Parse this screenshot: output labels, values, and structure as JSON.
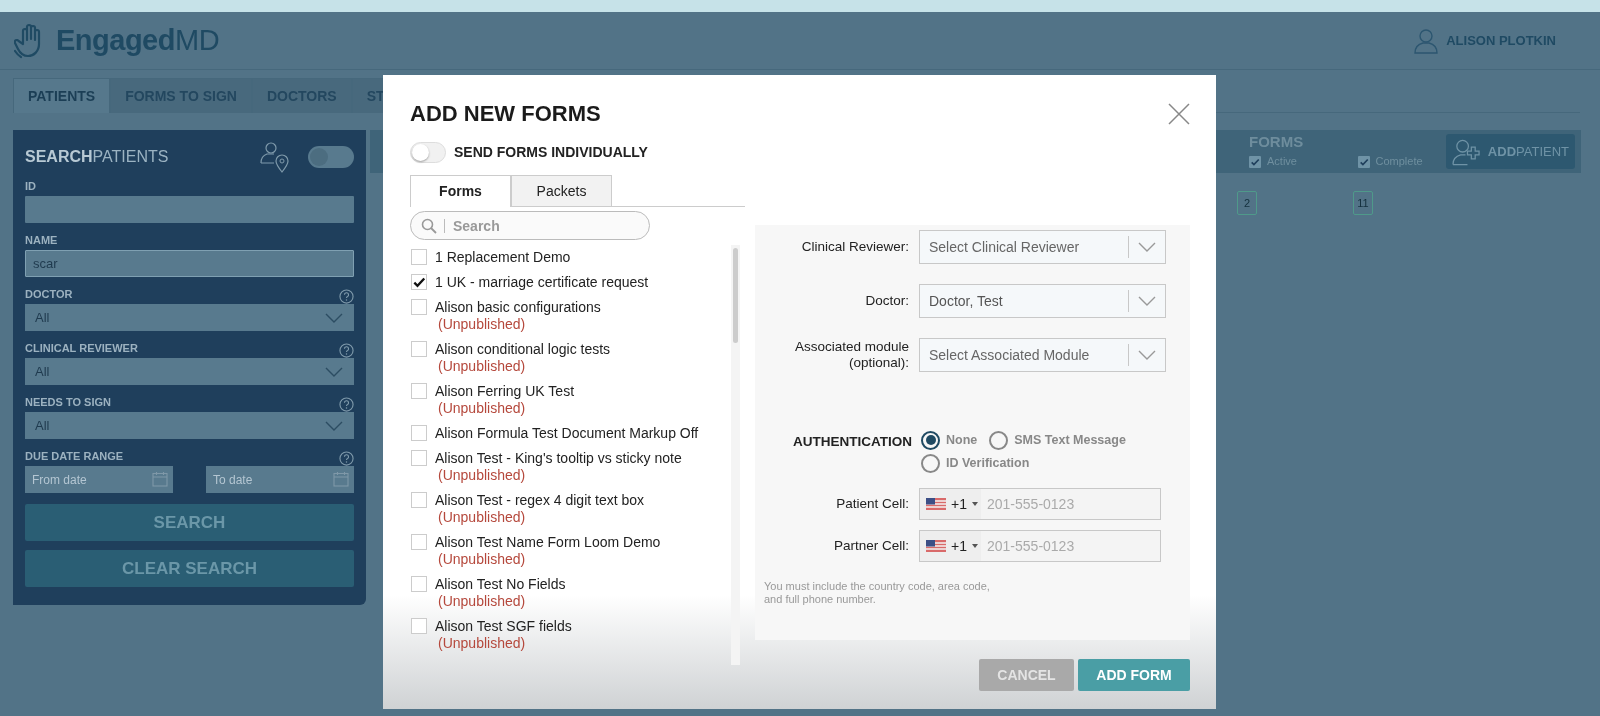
{
  "header": {
    "logo_bold": "Engaged",
    "logo_light": "MD",
    "user": "ALISON PLOTKIN"
  },
  "nav_tabs": [
    {
      "label": "PATIENTS",
      "selected": true
    },
    {
      "label": "FORMS TO SIGN",
      "selected": false
    },
    {
      "label": "DOCTORS",
      "selected": false
    },
    {
      "label": "ST",
      "selected": false
    }
  ],
  "search_panel": {
    "title_bold": "SEARCH",
    "title_light": "PATIENTS",
    "location_toggle_on": false,
    "fields": [
      {
        "kind": "text",
        "label": "ID"
      },
      {
        "kind": "text",
        "label": "NAME",
        "value": "scar"
      },
      {
        "kind": "select",
        "label": "DOCTOR",
        "value": "All"
      },
      {
        "kind": "select",
        "label": "CLINICAL REVIEWER",
        "value": "All"
      },
      {
        "kind": "select",
        "label": "NEEDS TO SIGN",
        "value": "All"
      },
      {
        "kind": "daterange",
        "label": "DUE DATE RANGE",
        "from_placeholder": "From date",
        "to_placeholder": "To date"
      }
    ],
    "buttons": [
      "SEARCH",
      "CLEAR SEARCH"
    ]
  },
  "patients_table": {
    "forms_heading": "FORMS",
    "filters": [
      {
        "label": "Active",
        "checked": true
      },
      {
        "label": "Complete",
        "checked": true
      }
    ],
    "add_button_bold": "ADD",
    "add_button_light": "PATIENT",
    "counts": [
      "2",
      "11"
    ]
  },
  "modal": {
    "title": "ADD NEW FORMS",
    "send_individually": {
      "label": "SEND FORMS INDIVIDUALLY",
      "on": false
    },
    "tabs": [
      {
        "label": "Forms",
        "selected": true
      },
      {
        "label": "Packets",
        "selected": false
      }
    ],
    "search": {
      "placeholder": "Search"
    },
    "forms": [
      {
        "name": "1 Replacement Demo",
        "checked": false
      },
      {
        "name": "1 UK - marriage certificate request",
        "checked": true
      },
      {
        "name": "Alison basic configurations",
        "checked": false,
        "status": "(Unpublished)"
      },
      {
        "name": "Alison conditional logic tests",
        "checked": false,
        "status": "(Unpublished)"
      },
      {
        "name": "Alison Ferring UK Test",
        "checked": false,
        "status": "(Unpublished)"
      },
      {
        "name": "Alison Formula Test Document Markup Off",
        "checked": false
      },
      {
        "name": "Alison Test - King's tooltip vs sticky note",
        "checked": false,
        "status": "(Unpublished)"
      },
      {
        "name": "Alison Test - regex 4 digit text box",
        "checked": false,
        "status": "(Unpublished)"
      },
      {
        "name": "Alison Test Name Form Loom Demo",
        "checked": false,
        "status": "(Unpublished)"
      },
      {
        "name": "Alison Test No Fields",
        "checked": false,
        "status": "(Unpublished)"
      },
      {
        "name": "Alison Test SGF fields",
        "checked": false,
        "status": "(Unpublished)"
      }
    ],
    "fields": [
      {
        "label": "Clinical Reviewer:",
        "placeholder": "Select Clinical Reviewer"
      },
      {
        "label": "Doctor:",
        "value": "Doctor, Test"
      },
      {
        "label": "Associated module (optional):",
        "placeholder": "Select Associated Module"
      }
    ],
    "authentication": {
      "label": "AUTHENTICATION",
      "options": [
        {
          "label": "None",
          "selected": true
        },
        {
          "label": "SMS Text Message",
          "selected": false
        },
        {
          "label": "ID Verification",
          "selected": false
        }
      ]
    },
    "phones": [
      {
        "label": "Patient Cell:",
        "code": "+1",
        "placeholder": "201-555-0123"
      },
      {
        "label": "Partner Cell:",
        "code": "+1",
        "placeholder": "201-555-0123"
      }
    ],
    "note": "You must include the country code, area code, and full phone number.",
    "buttons": [
      {
        "label": "CANCEL",
        "kind": "secondary"
      },
      {
        "label": "ADD FORM",
        "kind": "primary"
      }
    ]
  }
}
